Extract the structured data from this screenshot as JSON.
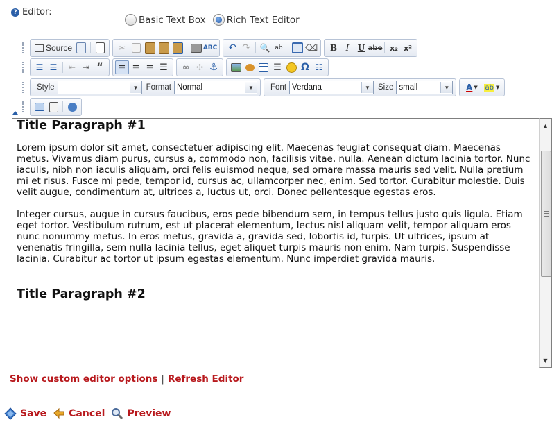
{
  "editor_label": "Editor:",
  "editor_mode": {
    "options": [
      {
        "label": "Basic Text Box",
        "selected": false
      },
      {
        "label": "Rich Text Editor",
        "selected": true
      }
    ]
  },
  "toolbar": {
    "source_label": "Source",
    "style": {
      "label": "Style",
      "value": ""
    },
    "format": {
      "label": "Format",
      "value": "Normal"
    },
    "font": {
      "label": "Font",
      "value": "Verdana"
    },
    "size": {
      "label": "Size",
      "value": "small"
    },
    "bold_glyph": "B",
    "italic_glyph": "I",
    "underline_glyph": "U",
    "strike_glyph": "abe",
    "subscript_glyph": "x₂",
    "superscript_glyph": "x²",
    "special_char_glyph": "Ω",
    "text_color_glyph": "A",
    "bg_color_glyph": "ab"
  },
  "content": {
    "title1": "Title Paragraph #1",
    "paragraph1": "Lorem ipsum dolor sit amet, consectetuer adipiscing elit. Maecenas feugiat consequat diam. Maecenas metus. Vivamus diam purus, cursus a, commodo non, facilisis vitae, nulla. Aenean dictum lacinia tortor. Nunc iaculis, nibh non iaculis aliquam, orci felis euismod neque, sed ornare massa mauris sed velit. Nulla pretium mi et risus. Fusce mi pede, tempor id, cursus ac, ullamcorper nec, enim. Sed tortor. Curabitur molestie. Duis velit augue, condimentum at, ultrices a, luctus ut, orci. Donec pellentesque egestas eros.",
    "paragraph2": "Integer cursus, augue in cursus faucibus, eros pede bibendum sem, in tempus tellus justo quis ligula. Etiam eget tortor. Vestibulum rutrum, est ut placerat elementum, lectus nisl aliquam velit, tempor aliquam eros nunc nonummy metus. In eros metus, gravida a, gravida sed, lobortis id, turpis. Ut ultrices, ipsum at venenatis fringilla, sem nulla lacinia tellus, eget aliquet turpis mauris non enim. Nam turpis. Suspendisse lacinia. Curabitur ac tortor ut ipsum egestas elementum. Nunc imperdiet gravida mauris.",
    "title2": "Title Paragraph #2"
  },
  "links": {
    "show_options": "Show custom editor options",
    "separator": "|",
    "refresh": "Refresh Editor"
  },
  "actions": {
    "save": "Save",
    "cancel": "Cancel",
    "preview": "Preview"
  },
  "colors": {
    "link_red": "#b8191d",
    "toolbar_border": "#b7c3d6",
    "accent_blue": "#2a5fa8"
  }
}
